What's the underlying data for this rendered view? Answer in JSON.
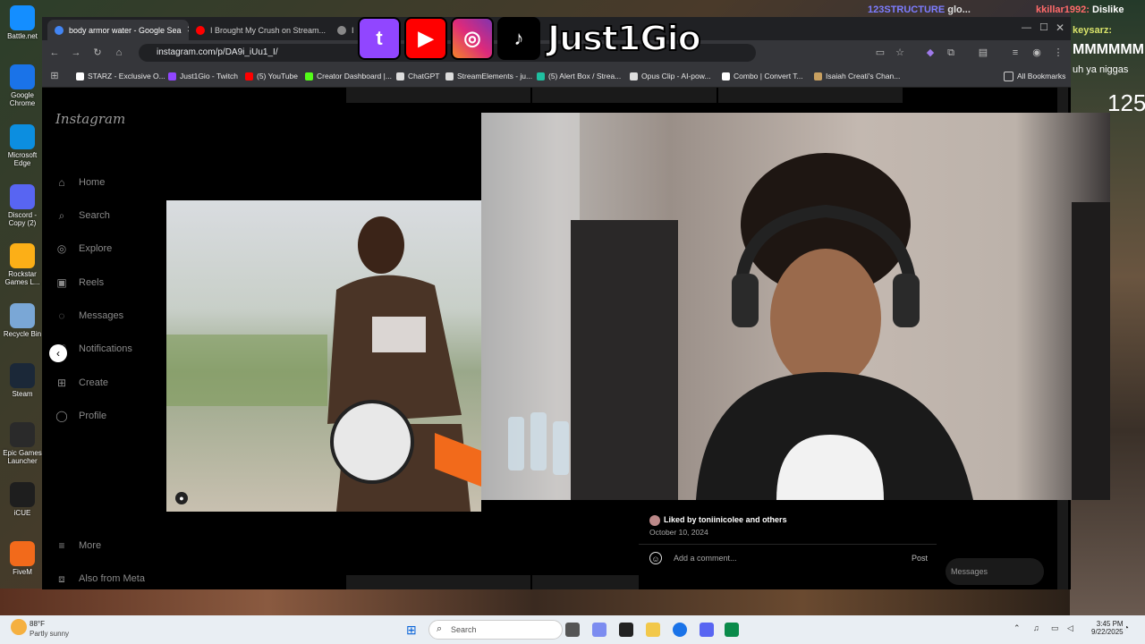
{
  "desktop": {
    "icons": [
      {
        "label": "Battle.net",
        "icon": "battlenet-icon",
        "color": "#148eff"
      },
      {
        "label": "Google Chrome",
        "icon": "chrome-icon",
        "color": "#1a73e8"
      },
      {
        "label": "Microsoft Edge",
        "icon": "edge-icon",
        "color": "#0c8ee0"
      },
      {
        "label": "Discord - Copy (2)",
        "icon": "discord-icon",
        "color": "#5865f2"
      },
      {
        "label": "Rockstar Games L...",
        "icon": "rockstar-icon",
        "color": "#fcaf17"
      },
      {
        "label": "Recycle Bin",
        "icon": "recycle-bin-icon",
        "color": "#7aa7d6"
      },
      {
        "label": "Steam",
        "icon": "steam-icon",
        "color": "#1b2838"
      },
      {
        "label": "Epic Games Launcher",
        "icon": "epic-games-icon",
        "color": "#2a2a2a"
      },
      {
        "label": "iCUE",
        "icon": "icue-icon",
        "color": "#1e1e1e"
      },
      {
        "label": "FiveM",
        "icon": "fivem-icon",
        "color": "#f26a1b"
      }
    ]
  },
  "stream_overlay": {
    "name": "Just1Gio",
    "socials": [
      "twitch-icon",
      "youtube-icon",
      "instagram-icon",
      "tiktok-icon"
    ],
    "chat": [
      {
        "user": "123STRUCTURE",
        "text": "glo...",
        "color": "#7d7dff"
      },
      {
        "user": "kkillar1992:",
        "text": "Dislike",
        "color": "#ff5a5a"
      },
      {
        "user": "keysarz:",
        "text": "",
        "color": "#d9e36a"
      },
      {
        "user": "",
        "text": "MMMMMMM",
        "color": "#ffffff"
      },
      {
        "user": "",
        "text": "uh ya niggas",
        "color": "#ffffff"
      },
      {
        "user": "",
        "text": "125",
        "color": "#ffffff"
      }
    ]
  },
  "browser": {
    "tabs": [
      {
        "label": "body armor water - Google Sea",
        "active": true,
        "fav_color": "#4285f4"
      },
      {
        "label": "I Brought My Crush on Stream...",
        "active": false,
        "fav_color": "#ff0000"
      },
      {
        "label": "I",
        "active": false,
        "fav_color": "#888888"
      }
    ],
    "url": "instagram.com/p/DA9i_iUu1_I/",
    "bookmarks": [
      {
        "label": "STARZ - Exclusive O...",
        "color": "#ffffff"
      },
      {
        "label": "Just1Gio - Twitch",
        "color": "#9146ff"
      },
      {
        "label": "(5) YouTube",
        "color": "#ff0000"
      },
      {
        "label": "Creator Dashboard |...",
        "color": "#53fc18"
      },
      {
        "label": "ChatGPT",
        "color": "#dddddd"
      },
      {
        "label": "StreamElements - ju...",
        "color": "#dddddd"
      },
      {
        "label": "(5) Alert Box / Strea...",
        "color": "#1fbfa0"
      },
      {
        "label": "Opus Clip - AI-pow...",
        "color": "#dddddd"
      },
      {
        "label": "Combo | Convert T...",
        "color": "#ffffff"
      },
      {
        "label": "Isaiah Creati's Chan...",
        "color": "#c8a060"
      }
    ],
    "all_bookmarks": "All Bookmarks"
  },
  "instagram": {
    "logo": "Instagram",
    "nav": [
      {
        "label": "Home",
        "icon": "home-icon",
        "glyph": "⌂"
      },
      {
        "label": "Search",
        "icon": "search-icon",
        "glyph": "⌕"
      },
      {
        "label": "Explore",
        "icon": "explore-icon",
        "glyph": "◎"
      },
      {
        "label": "Reels",
        "icon": "reels-icon",
        "glyph": "▣"
      },
      {
        "label": "Messages",
        "icon": "messages-icon",
        "glyph": "◌"
      },
      {
        "label": "Notifications",
        "icon": "notifications-icon",
        "glyph": "♡"
      },
      {
        "label": "Create",
        "icon": "create-icon",
        "glyph": "⊞"
      },
      {
        "label": "Profile",
        "icon": "profile-icon",
        "glyph": "◯"
      }
    ],
    "more": "More",
    "also_from_meta": "Also from Meta",
    "post": {
      "liked_by_prefix": "Liked by",
      "liked_by_user": "toniinicolee",
      "liked_by_suffix": "and others",
      "date": "October 10, 2024",
      "comment_placeholder": "Add a comment...",
      "post_button": "Post",
      "messages": "Messages"
    }
  },
  "taskbar": {
    "weather_temp": "88°F",
    "weather_desc": "Partly sunny",
    "search_placeholder": "Search",
    "time": "3:45 PM",
    "date": "9/22/2025"
  }
}
